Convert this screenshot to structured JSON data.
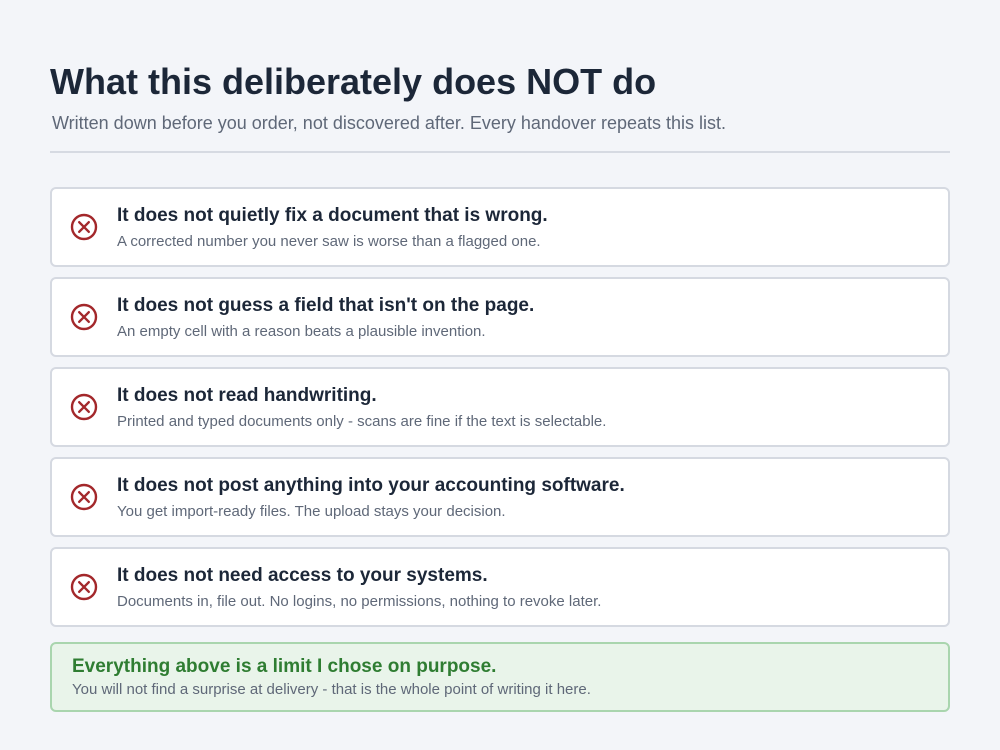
{
  "header": {
    "title": "What this deliberately does NOT do",
    "subtitle": "Written down before you order, not discovered after. Every handover repeats this list."
  },
  "items": [
    {
      "icon": "x-circle-icon",
      "title": "It does not quietly fix a document that is wrong.",
      "detail": "A corrected number you never saw is worse than a flagged one."
    },
    {
      "icon": "x-circle-icon",
      "title": "It does not guess a field that isn't on the page.",
      "detail": "An empty cell with a reason beats a plausible invention."
    },
    {
      "icon": "x-circle-icon",
      "title": "It does not read handwriting.",
      "detail": "Printed and typed documents only - scans are fine if the text is selectable."
    },
    {
      "icon": "x-circle-icon",
      "title": "It does not post anything into your accounting software.",
      "detail": "You get import-ready files. The upload stays your decision."
    },
    {
      "icon": "x-circle-icon",
      "title": "It does not need access to your systems.",
      "detail": "Documents in, file out. No logins, no permissions, nothing to revoke later."
    }
  ],
  "note": {
    "title": "Everything above is a limit I chose on purpose.",
    "text": "You will not find a surprise at delivery - that is the whole point of writing it here."
  },
  "colors": {
    "background": "#f3f5f9",
    "icon_red": "#a3282b",
    "note_green": "#2f7d32",
    "note_background": "#e9f4ea"
  }
}
